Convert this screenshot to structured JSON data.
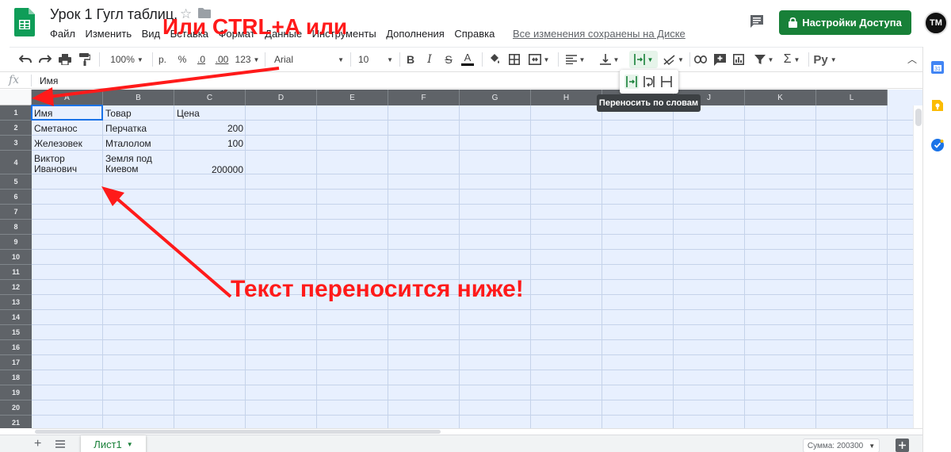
{
  "header": {
    "title": "Урок 1 Гугл таблиц.",
    "save_status": "Все изменения сохранены на Диске",
    "share_label": "Настройки Доступа",
    "avatar_initials": "TM"
  },
  "menu": {
    "items": [
      "Файл",
      "Изменить",
      "Вид",
      "Вставка",
      "Формат",
      "Данные",
      "Инструменты",
      "Дополнения",
      "Справка"
    ]
  },
  "toolbar": {
    "zoom": "100%",
    "currency": "р.",
    "percent": "%",
    "decrease_decimal": ".0",
    "increase_decimal": ".00",
    "number_format": "123",
    "font": "Arial",
    "font_size": "10",
    "bold": "B",
    "italic": "I",
    "strike": "S",
    "text_color": "A",
    "input_tools": "Ру"
  },
  "tooltip": {
    "wrap": "Переносить по словам"
  },
  "formula_bar": {
    "fx": "fx",
    "value": "Имя"
  },
  "grid": {
    "columns": [
      "A",
      "B",
      "C",
      "D",
      "E",
      "F",
      "G",
      "H",
      "I",
      "J",
      "K",
      "L"
    ],
    "rows": [
      "1",
      "2",
      "3",
      "4",
      "5",
      "6",
      "7",
      "8",
      "9",
      "10",
      "11",
      "12",
      "13",
      "14",
      "15",
      "16",
      "17",
      "18",
      "19",
      "20",
      "21"
    ],
    "cells": {
      "a1": "Имя",
      "b1": "Товар",
      "c1": "Цена",
      "a2": "Сметанос",
      "b2": "Перчатка",
      "c2": "200",
      "a3": "Железовек",
      "b3": "Мталолом",
      "c3": "100",
      "a4_line1": "Виктор",
      "a4_line2": "Иванович",
      "b4_line1": "Земля под",
      "b4_line2": "Киевом",
      "c4": "200000"
    }
  },
  "sheets": {
    "tab_label": "Лист1"
  },
  "status": {
    "sum": "Сумма: 200300"
  },
  "annotations": {
    "top": "Или CTRL+A или",
    "middle": "Текст переносится ниже!"
  },
  "colors": {
    "accent_green": "#188038",
    "selection_blue": "#e8f0fe",
    "header_dark": "#5f6368",
    "annotation_red": "#ff1a1a"
  }
}
